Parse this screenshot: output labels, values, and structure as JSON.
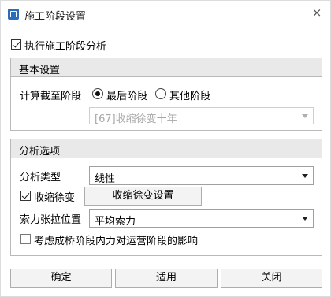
{
  "window": {
    "title": "施工阶段设置",
    "close_glyph": "×"
  },
  "execute": {
    "label": "执行施工阶段分析",
    "checked": true
  },
  "basic": {
    "header": "基本设置",
    "calc_label": "计算截至阶段",
    "radio_last": "最后阶段",
    "radio_other": "其他阶段",
    "selected_radio": "最后阶段",
    "stage_select_value": "[67]收缩徐变十年"
  },
  "analysis": {
    "header": "分析选项",
    "type_label": "分析类型",
    "type_value": "线性",
    "shrink_label": "收缩徐变",
    "shrink_checked": true,
    "shrink_button": "收缩徐变设置",
    "tension_label": "索力张拉位置",
    "tension_value": "平均索力",
    "consider_label": "考虑成桥阶段内力对运营阶段的影响",
    "consider_checked": false
  },
  "footer": {
    "ok": "确定",
    "apply": "适用",
    "close": "关闭"
  }
}
